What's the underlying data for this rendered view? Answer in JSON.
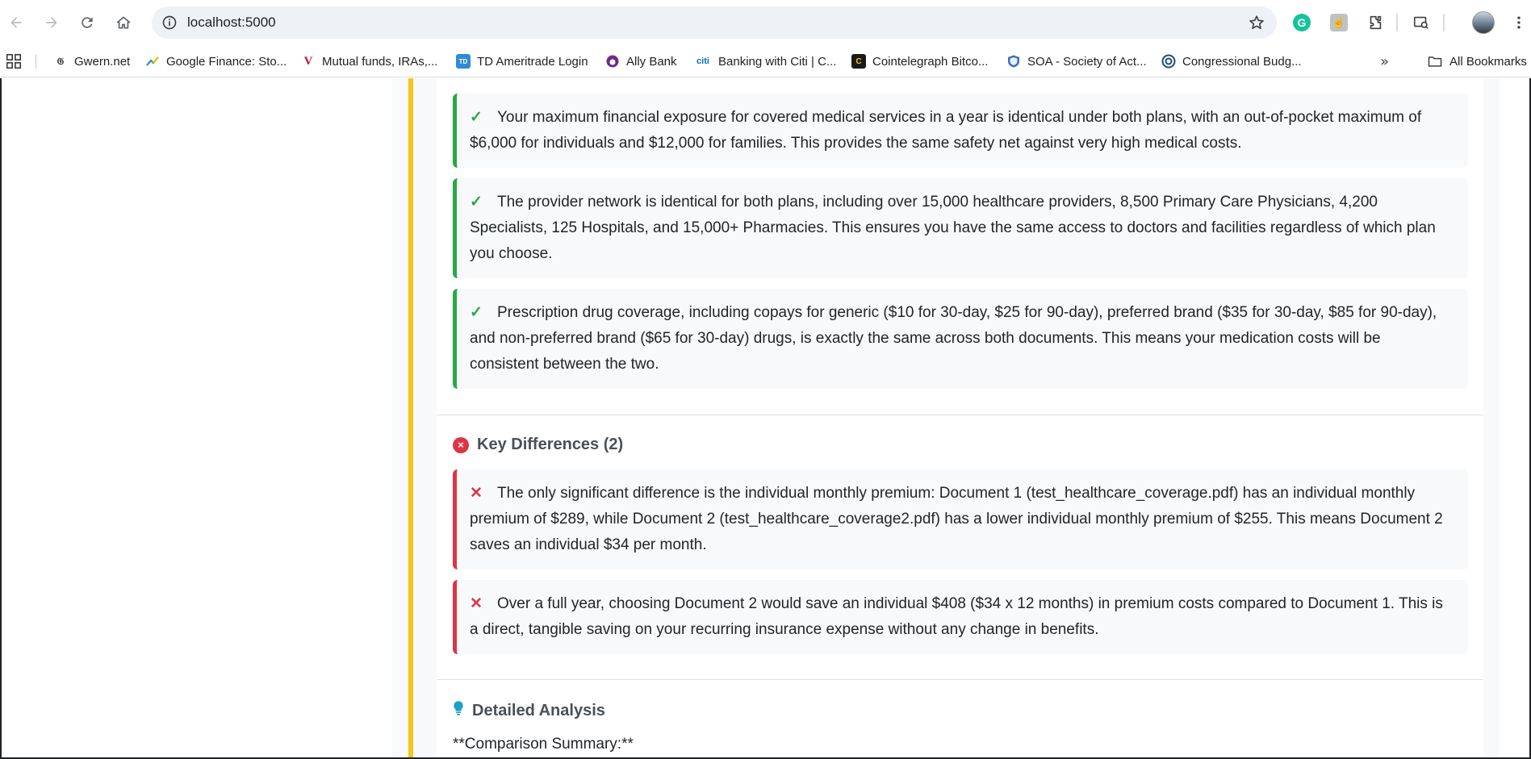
{
  "browser": {
    "url": "localhost:5000",
    "bookmarks": [
      {
        "label": "Gwern.net",
        "icon": "gwern-icon"
      },
      {
        "label": "Google Finance: Sto...",
        "icon": "google-finance-icon"
      },
      {
        "label": "Mutual funds, IRAs,...",
        "icon": "vanguard-icon"
      },
      {
        "label": "TD Ameritrade Login",
        "icon": "td-ameritrade-icon"
      },
      {
        "label": "Ally Bank",
        "icon": "ally-icon"
      },
      {
        "label": "Banking with Citi | C...",
        "icon": "citi-icon"
      },
      {
        "label": "Cointelegraph Bitco...",
        "icon": "cointelegraph-icon"
      },
      {
        "label": "SOA - Society of Act...",
        "icon": "soa-icon"
      },
      {
        "label": "Congressional Budg...",
        "icon": "cbo-icon"
      }
    ],
    "all_bookmarks_label": "All Bookmarks"
  },
  "similarities": [
    {
      "text": "Your maximum financial exposure for covered medical services in a year is identical under both plans, with an out-of-pocket maximum of $6,000 for individuals and $12,000 for families. This provides the same safety net against very high medical costs."
    },
    {
      "text": "The provider network is identical for both plans, including over 15,000 healthcare providers, 8,500 Primary Care Physicians, 4,200 Specialists, 125 Hospitals, and 15,000+ Pharmacies. This ensures you have the same access to doctors and facilities regardless of which plan you choose."
    },
    {
      "text": "Prescription drug coverage, including copays for generic ($10 for 30-day, $25 for 90-day), preferred brand ($35 for 30-day, $85 for 90-day), and non-preferred brand ($65 for 30-day) drugs, is exactly the same across both documents. This means your medication costs will be consistent between the two."
    }
  ],
  "differences": {
    "title": "Key Differences (2)",
    "items": [
      {
        "text": "The only significant difference is the individual monthly premium: Document 1 (test_healthcare_coverage.pdf) has an individual monthly premium of $289, while Document 2 (test_healthcare_coverage2.pdf) has a lower individual monthly premium of $255. This means Document 2 saves an individual $34 per month."
      },
      {
        "text": "Over a full year, choosing Document 2 would save an individual $408 ($34 x 12 months) in premium costs compared to Document 1. This is a direct, tangible saving on your recurring insurance expense without any change in benefits."
      }
    ]
  },
  "analysis": {
    "title": "Detailed Analysis",
    "summary_line": "**Comparison Summary:**"
  },
  "marks": {
    "check": "✓",
    "cross": "✕",
    "circle_x": "×"
  },
  "colors": {
    "similar_accent": "#28a745",
    "difference_accent": "#dc3545",
    "section_accent_bar": "#f5c518",
    "info_accent": "#17a2c8"
  }
}
